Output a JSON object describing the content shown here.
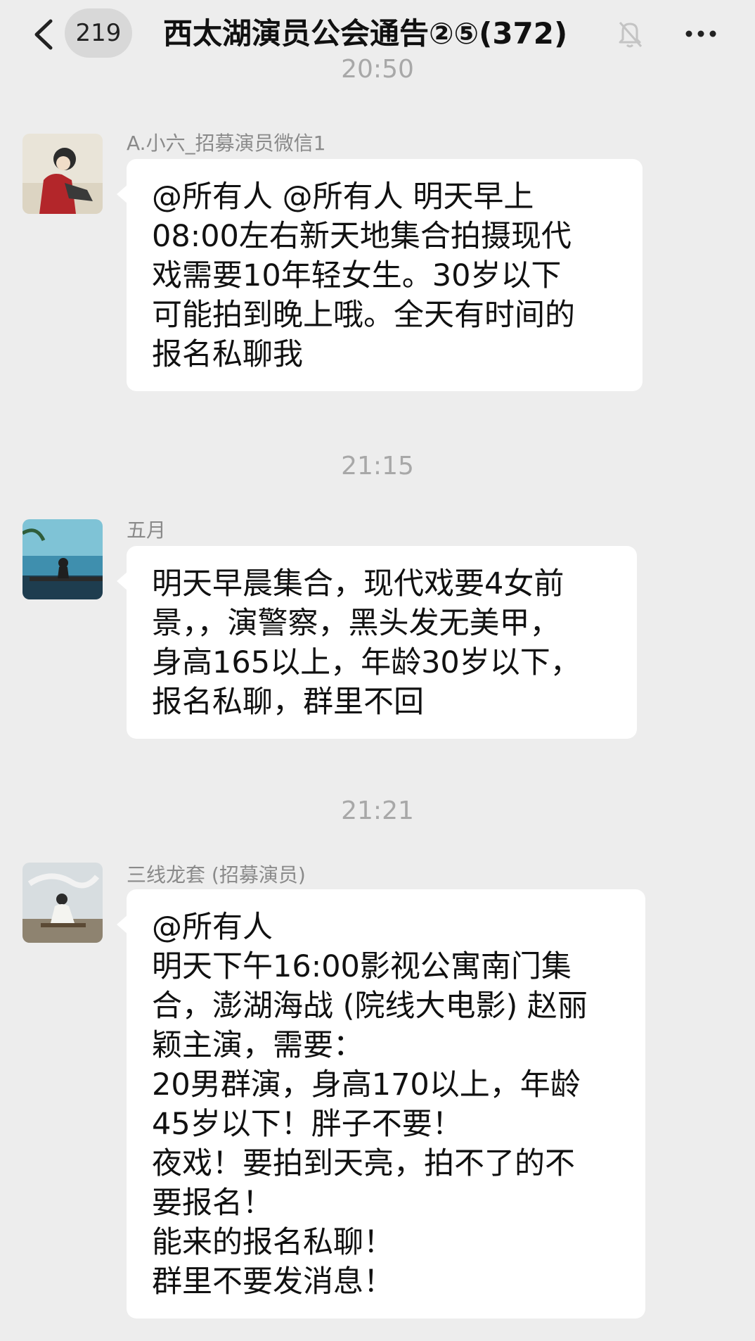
{
  "header": {
    "unread_count": "219",
    "title": "西太湖演员公会通告②⑤(372)",
    "icons": {
      "back": "chevron-left-icon",
      "mute": "bell-off-icon",
      "more": "more-dots-icon"
    }
  },
  "messages": [
    {
      "time": "20:50",
      "sender": "A.小六_招募演员微信1",
      "text": "@所有人 @所有人 明天早上\n08:00左右新天地集合拍摄现代\n戏需要10年轻女生。30岁以下\n可能拍到晚上哦。全天有时间的\n报名私聊我"
    },
    {
      "time": "21:15",
      "sender": "五月",
      "text": "明天早晨集合，现代戏要4女前\n景，，演警察，黑头发无美甲，\n身高165以上，年龄30岁以下，\n报名私聊，群里不回"
    },
    {
      "time": "21:21",
      "sender": "三线龙套 (招募演员)",
      "text": "@所有人\n明天下午16:00影视公寓南门集\n合，澎湖海战 (院线大电影) 赵丽\n颖主演，需要：\n20男群演，身高170以上，年龄\n45岁以下！胖子不要！\n夜戏！要拍到天亮，拍不了的不\n要报名！\n能来的报名私聊！\n群里不要发消息！"
    }
  ],
  "colors": {
    "background": "#ededed",
    "bubble": "#ffffff",
    "timestamp": "#a8a8a8",
    "sender_name": "#8a8a8a"
  }
}
